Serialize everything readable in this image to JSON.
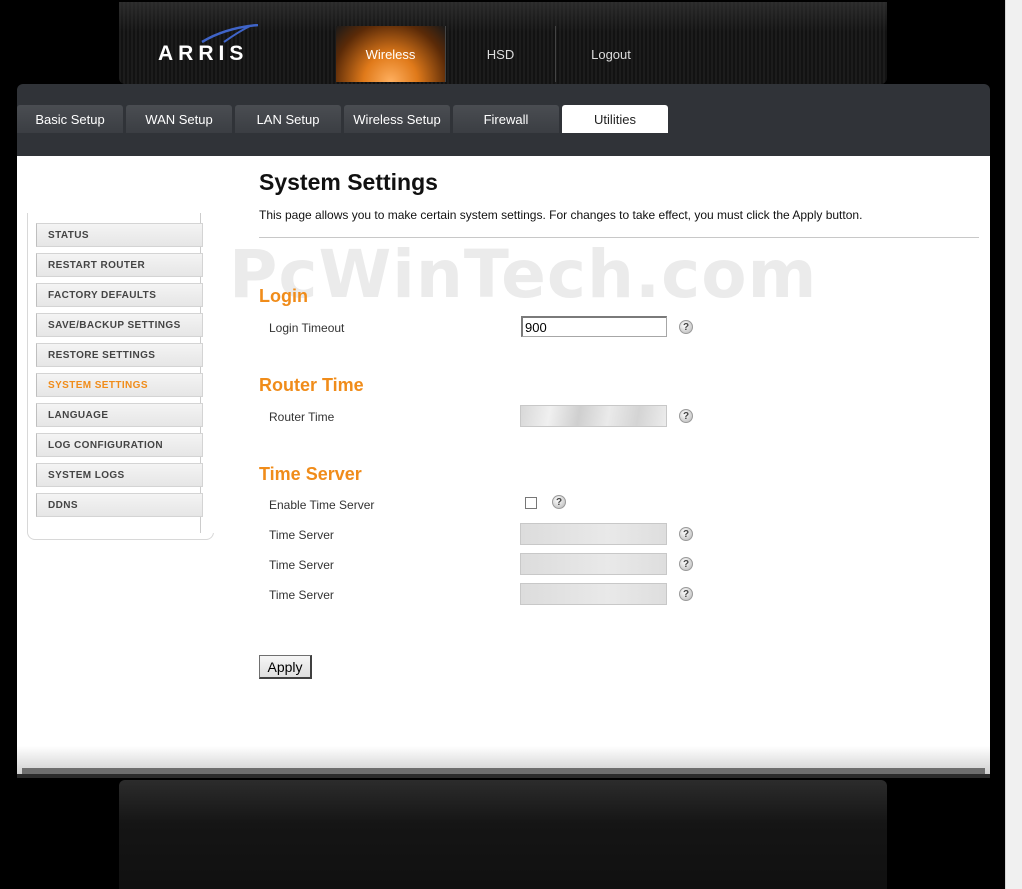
{
  "brand": {
    "logo_text": "ARRIS"
  },
  "top_nav": [
    {
      "label": "Wireless",
      "active": true
    },
    {
      "label": "HSD",
      "active": false
    },
    {
      "label": "Logout",
      "active": false
    }
  ],
  "tabs": [
    {
      "label": "Basic Setup",
      "active": false
    },
    {
      "label": "WAN Setup",
      "active": false
    },
    {
      "label": "LAN Setup",
      "active": false
    },
    {
      "label": "Wireless Setup",
      "active": false
    },
    {
      "label": "Firewall",
      "active": false
    },
    {
      "label": "Utilities",
      "active": true
    }
  ],
  "sidebar": {
    "items": [
      {
        "label": "STATUS"
      },
      {
        "label": "RESTART ROUTER"
      },
      {
        "label": "FACTORY DEFAULTS"
      },
      {
        "label": "SAVE/BACKUP SETTINGS"
      },
      {
        "label": "RESTORE SETTINGS"
      },
      {
        "label": "SYSTEM SETTINGS",
        "active": true
      },
      {
        "label": "LANGUAGE"
      },
      {
        "label": "LOG CONFIGURATION"
      },
      {
        "label": "SYSTEM LOGS"
      },
      {
        "label": "DDNS"
      }
    ]
  },
  "main": {
    "title": "System Settings",
    "description": "This page allows you to make certain system settings. For changes to take effect, you must click the Apply button.",
    "watermark": "PcWinTech.com",
    "login": {
      "heading": "Login",
      "timeout_label": "Login Timeout",
      "timeout_value": "900"
    },
    "router_time": {
      "heading": "Router Time",
      "label": "Router Time"
    },
    "time_server": {
      "heading": "Time Server",
      "enable_label": "Enable Time Server",
      "enabled": false,
      "server_label": "Time Server"
    },
    "help_glyph": "?",
    "apply_label": "Apply"
  },
  "colors": {
    "accent_orange": "#f08c1a",
    "panel_dark": "#303338",
    "background": "#000000"
  }
}
